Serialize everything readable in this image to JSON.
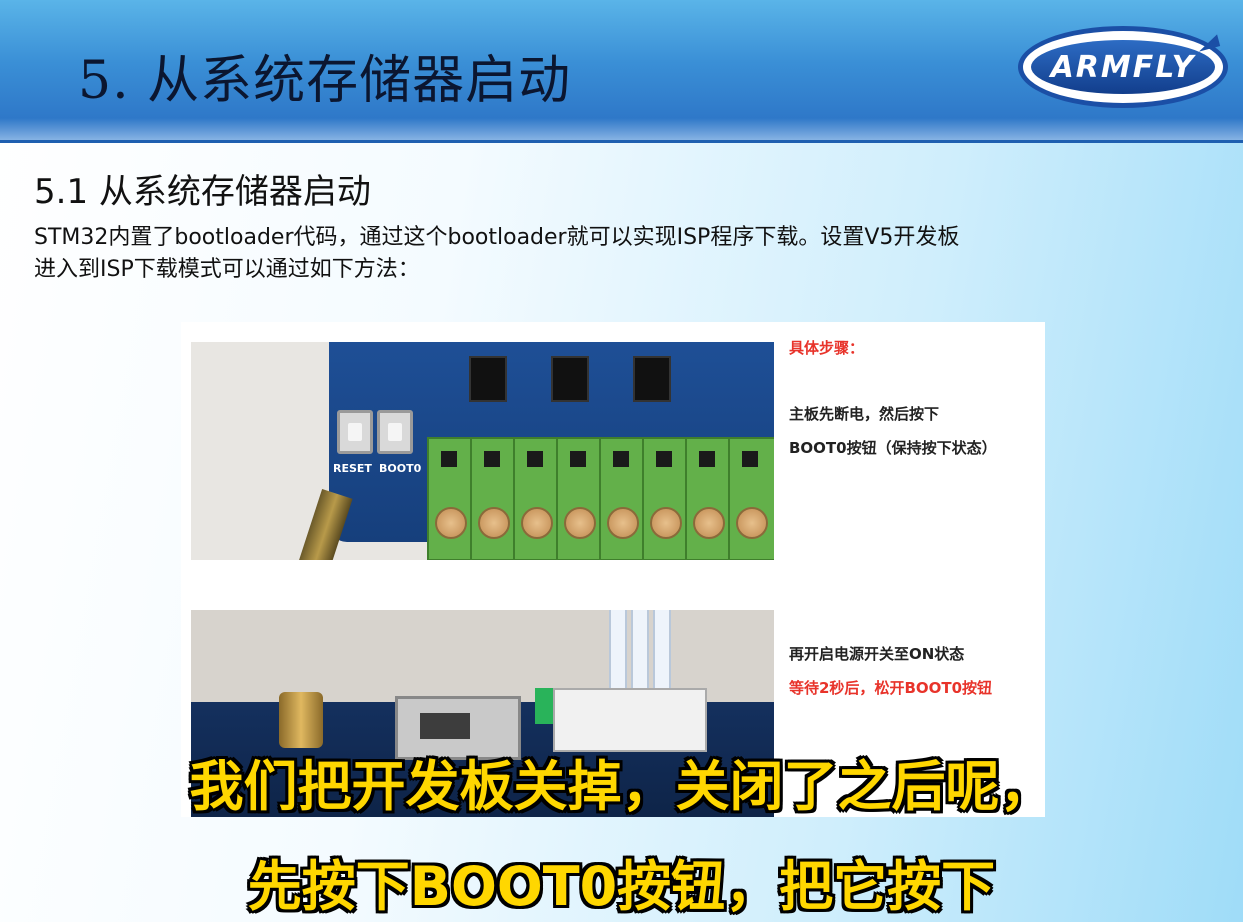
{
  "header": {
    "title": "5. 从系统存储器启动",
    "logo_text": "ARMFLY"
  },
  "section": {
    "subtitle": "5.1 从系统存储器启动",
    "intro_line1": "STM32内置了bootloader代码，通过这个bootloader就可以实现ISP程序下载。设置V5开发板",
    "intro_line2": "进入到ISP下载模式可以通过如下方法："
  },
  "figure": {
    "board_labels": {
      "reset": "RESET",
      "boot": "BOOT0"
    },
    "steps_heading": "具体步骤：",
    "step1_line1": "主板先断电，然后按下",
    "step1_line2": "BOOT0按钮（保持按下状态）",
    "step2_line1": "再开启电源开关至ON状态",
    "step2_line2": "等待2秒后，松开BOOT0按钮"
  },
  "captions": {
    "line1": "我们把开发板关掉，关闭了之后呢，",
    "line2": "先按下BOOT0按钮，把它按下"
  },
  "colors": {
    "header_blue": "#2a6fc3",
    "step_red": "#e8332a",
    "caption_yellow": "#ffd700"
  }
}
